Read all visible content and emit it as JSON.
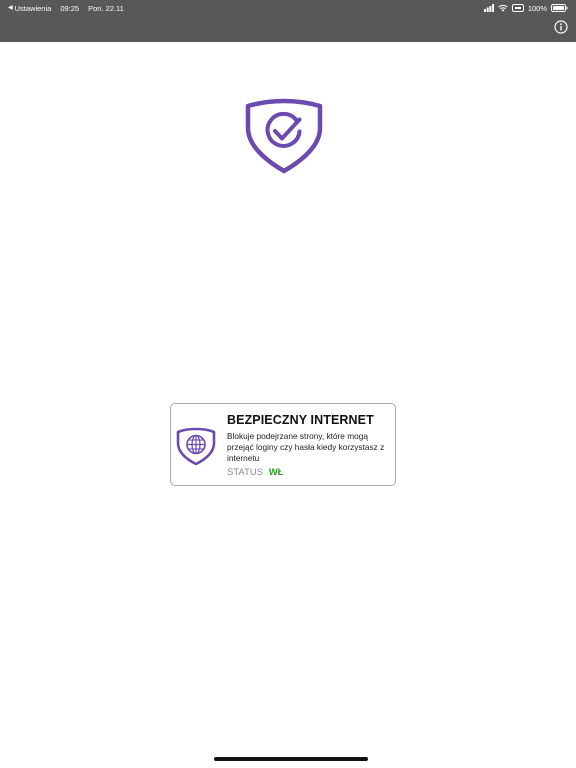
{
  "status_bar": {
    "back_app": "Ustawienia",
    "time": "09:25",
    "date": "Pon. 22.11",
    "battery": "100%"
  },
  "nav": {
    "info_icon": "info-icon"
  },
  "logo": {
    "icon": "shield-check-icon",
    "color": "#6b4bb0"
  },
  "feature_card": {
    "title": "BEZPIECZNY INTERNET",
    "description": "Blokuje podejrzane strony, które mogą przejąć loginy czy hasła kiedy korzystasz z internetu",
    "status_label": "STATUS",
    "status_value": "WŁ",
    "status_color": "#2e9a2a",
    "icon": "shield-globe-icon"
  }
}
